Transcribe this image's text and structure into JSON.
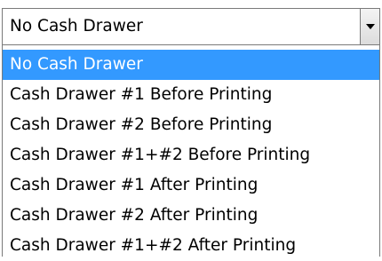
{
  "combo": {
    "value": "No Cash Drawer",
    "dropdown_icon": "chevron-down-icon"
  },
  "list": {
    "selected_index": 0,
    "selection_color": "#3399ff",
    "items": [
      "No Cash Drawer",
      "Cash Drawer #1 Before Printing",
      "Cash Drawer #2 Before Printing",
      "Cash Drawer #1+#2 Before Printing",
      "Cash Drawer #1 After Printing",
      "Cash Drawer #2 After Printing",
      "Cash Drawer #1+#2 After Printing"
    ]
  }
}
